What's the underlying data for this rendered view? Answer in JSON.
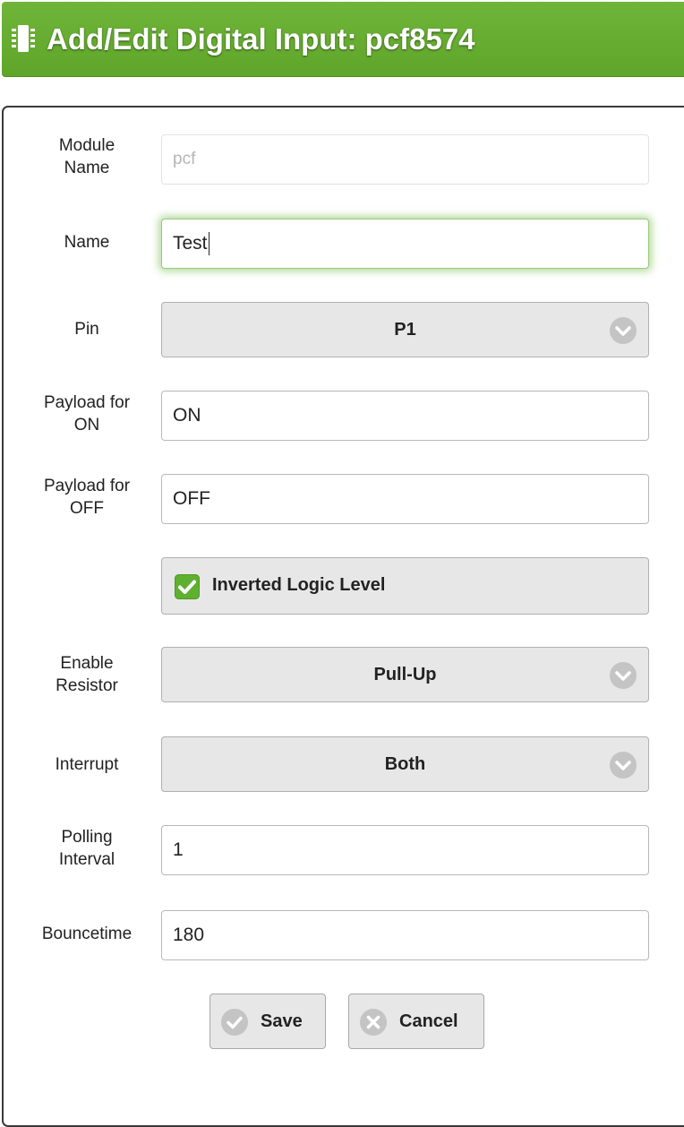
{
  "header": {
    "title": "Add/Edit Digital Input: pcf8574",
    "icon": "chip-icon",
    "color": "#63aa2f"
  },
  "form": {
    "module_name": {
      "label_1": "Module",
      "label_2": "Name",
      "placeholder": "pcf",
      "value": ""
    },
    "name": {
      "label": "Name",
      "value": "Test"
    },
    "pin": {
      "label": "Pin",
      "value": "P1"
    },
    "payload_on": {
      "label_1": "Payload for",
      "label_2": "ON",
      "value": "ON"
    },
    "payload_off": {
      "label_1": "Payload for",
      "label_2": "OFF",
      "value": "OFF"
    },
    "inverted": {
      "label": "Inverted Logic Level",
      "checked": true
    },
    "resistor": {
      "label_1": "Enable",
      "label_2": "Resistor",
      "value": "Pull-Up"
    },
    "interrupt": {
      "label": "Interrupt",
      "value": "Both"
    },
    "polling": {
      "label_1": "Polling",
      "label_2": "Interval",
      "value": "1"
    },
    "bouncetime": {
      "label": "Bouncetime",
      "value": "180"
    }
  },
  "buttons": {
    "save": "Save",
    "cancel": "Cancel"
  },
  "colors": {
    "accent": "#63aa2f",
    "control_bg": "#e7e7e7",
    "checkbox": "#5fb02f"
  }
}
